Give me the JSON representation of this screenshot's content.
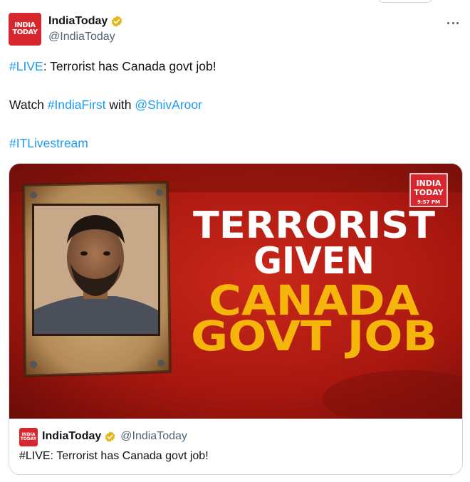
{
  "author": {
    "display_name": "IndiaToday",
    "handle": "@IndiaToday",
    "avatar_text_1": "INDIA",
    "avatar_text_2": "TODAY"
  },
  "tweet": {
    "line1_tag": "#LIVE",
    "line1_rest": ": Terrorist has Canada govt job!",
    "line2_prefix": "Watch ",
    "line2_tag": "#IndiaFirst",
    "line2_mid": " with ",
    "line2_mention": "@ShivAroor",
    "line3_tag": "#ITLivestream"
  },
  "media": {
    "headline_1": "TERRORIST",
    "headline_2": "GIVEN",
    "headline_3": "CANADA",
    "headline_4": "GOVT JOB",
    "logo_text_1": "INDIA",
    "logo_text_2": "TODAY",
    "logo_time": "9:57 PM"
  },
  "quote": {
    "display_name": "IndiaToday",
    "handle": "@IndiaToday",
    "text": "#LIVE: Terrorist has Canada govt job!"
  },
  "colors": {
    "link": "#1d9bf0",
    "brand_red": "#d7262d",
    "headline_white": "#ffffff",
    "headline_yellow": "#f5b50a",
    "verified_gold": "#e2b719"
  }
}
